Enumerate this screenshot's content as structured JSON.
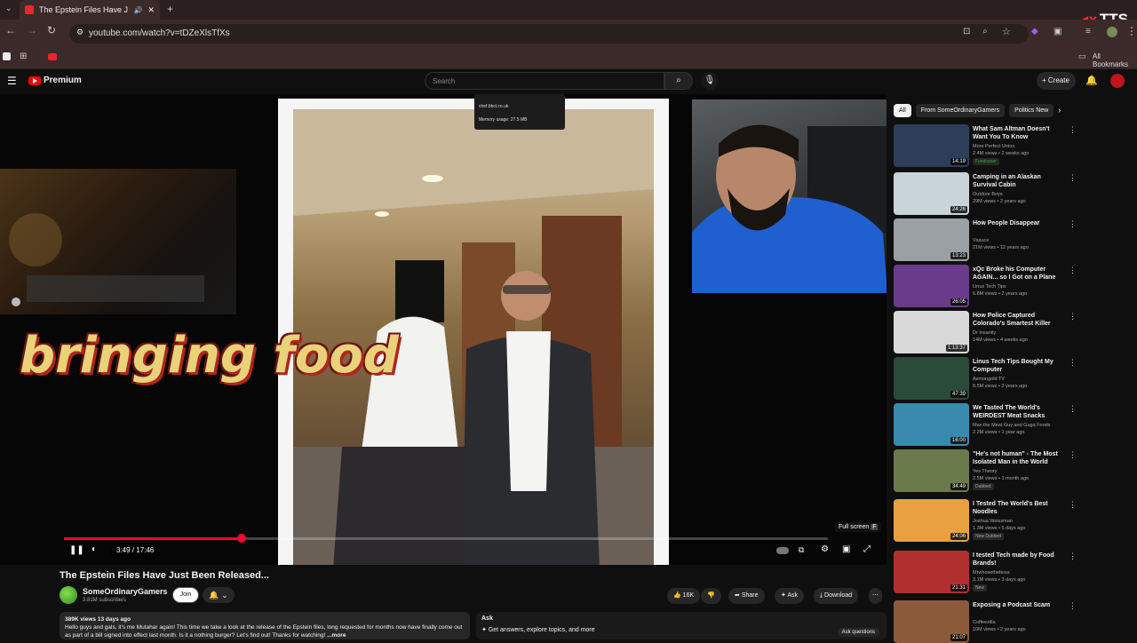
{
  "browser": {
    "tab_title": "The Epstein Files Have Just",
    "url": "youtube.com/watch?v=tDZeXlsTfXs",
    "bookmarks_label": "All Bookmarks",
    "tts_label": "TTS"
  },
  "header": {
    "logo_text": "Premium",
    "search_placeholder": "Search",
    "create_label": "Create"
  },
  "player": {
    "overlay_text": "bringing food",
    "memory_tip": [
      "chef.bbci.co.uk",
      "Memory usage: 27.5 MB"
    ],
    "time": "3:49 / 17:46",
    "progress": 0.232,
    "fullscreen_tip": "Full screen",
    "fullscreen_key": "F"
  },
  "video": {
    "title": "The Epstein Files Have Just Been Released...",
    "channel": "SomeOrdinaryGamers",
    "subscribers": "3.81M subscribers",
    "join_label": "Join",
    "likes": "16K",
    "share_label": "Share",
    "ask_label": "Ask",
    "download_label": "Download",
    "desc_stats": "389K views  13 days ago",
    "desc_text": "Hello guys and gals, it's me Mutahar again! This time we take a look at the release of the Epstein files, long requested for months now have finally come out as part of a bill signed into effect last month. Is it a nothing burger? Let's find out! Thanks for watching!",
    "desc_more": "...more",
    "ask_title": "Ask",
    "ask_text": "Get answers, explore topics, and more",
    "ask_button": "Ask questions"
  },
  "sidebar": {
    "chips": [
      "All",
      "From SomeOrdinaryGamers",
      "Politics New"
    ],
    "items": [
      {
        "title": "What Sam Altman Doesn't Want You To Know",
        "channel": "More Perfect Union",
        "meta": "2.4M views • 2 weeks ago",
        "duration": "14:19",
        "badge": "Fundraiser",
        "thumb": "#2d3e5a"
      },
      {
        "title": "Camping in an Alaskan Survival Cabin",
        "channel": "Outdoor Boys",
        "meta": "29M views • 2 years ago",
        "duration": "24:26",
        "badge": "",
        "thumb": "#c8d4d8"
      },
      {
        "title": "How People Disappear",
        "channel": "Vsauce",
        "meta": "21M views • 12 years ago",
        "duration": "13:23",
        "badge": "",
        "thumb": "#9aa0a4"
      },
      {
        "title": "xQc Broke his Computer AGAIN... so I Got on a Plane",
        "channel": "Linus Tech Tips",
        "meta": "6.8M views • 2 years ago",
        "duration": "26:05",
        "badge": "",
        "thumb": "#6a3b8a"
      },
      {
        "title": "How Police Captured Colorado's Smartest Killer",
        "channel": "Dr Insanity",
        "meta": "14M views • 4 weeks ago",
        "duration": "1:13:37",
        "badge": "",
        "thumb": "#d8d8d8"
      },
      {
        "title": "Linus Tech Tips Bought My Computer",
        "channel": "Asmongold TV",
        "meta": "8.5M views • 3 years ago",
        "duration": "47:39",
        "badge": "",
        "thumb": "#2a4a3a"
      },
      {
        "title": "We Tasted The World's WEIRDEST Meat Snacks",
        "channel": "Max the Meat Guy and Guga Foods",
        "meta": "2.2M views • 1 year ago",
        "duration": "16:00",
        "badge": "",
        "thumb": "#3a8ab0"
      },
      {
        "title": "\"He's not human\" - The Most Isolated Man in the World",
        "channel": "Yes Theory",
        "meta": "2.5M views • 1 month ago",
        "duration": "34:49",
        "badge": "Dubbed",
        "thumb": "#6a7a4a"
      },
      {
        "title": "I Tested The World's Best Noodles",
        "channel": "Joshua Weissman",
        "meta": "1.3M views • 5 days ago",
        "duration": "24:06",
        "badge": "New  Dubbed",
        "thumb": "#e8a040"
      },
      {
        "title": "I tested Tech made by Food Brands!",
        "channel": "Mrwhosetheboss",
        "meta": "3.1M views • 3 days ago",
        "duration": "21:31",
        "badge": "New",
        "thumb": "#b03030"
      },
      {
        "title": "Exposing a Podcast Scam",
        "channel": "Coffeezilla",
        "meta": "10M views • 2 years ago",
        "duration": "21:07",
        "badge": "",
        "thumb": "#8a5a3a"
      }
    ]
  }
}
